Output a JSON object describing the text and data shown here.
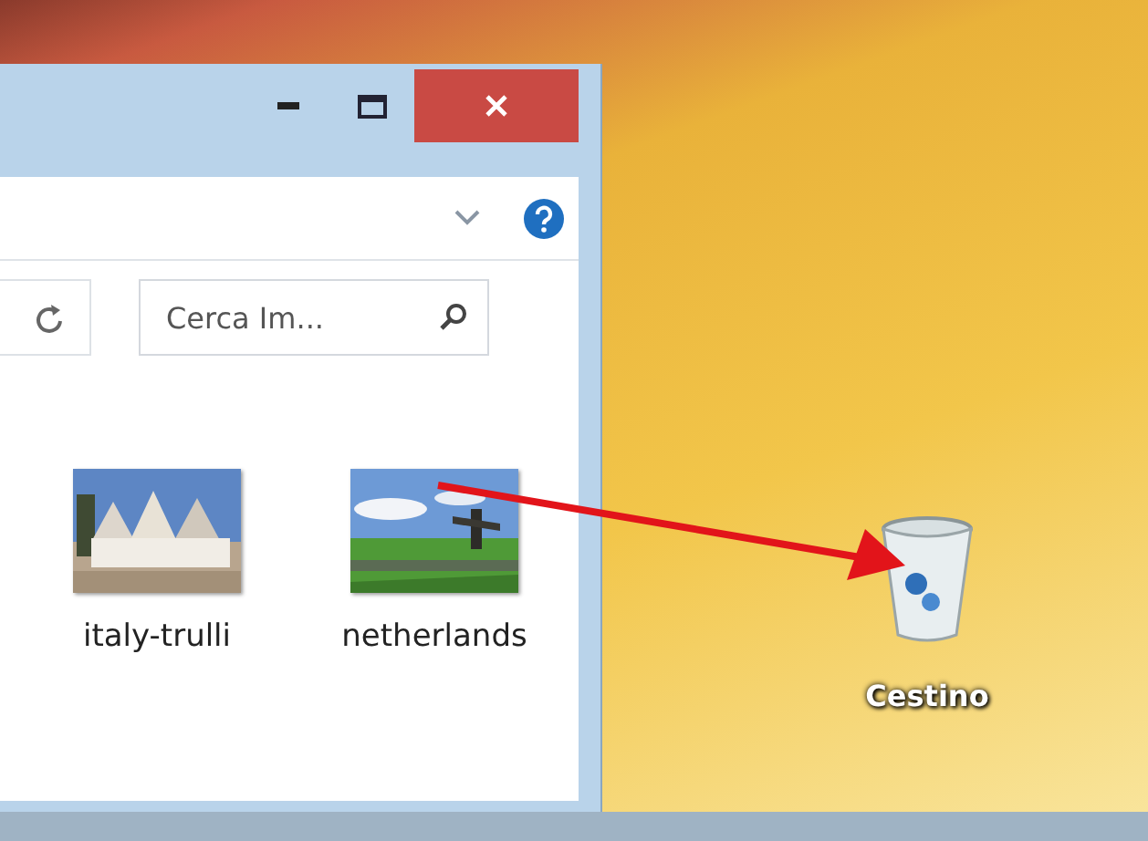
{
  "explorer": {
    "search": {
      "placeholder": "Cerca Im..."
    },
    "files": [
      {
        "name": "italy-trulli",
        "kind": "picture"
      },
      {
        "name": "netherlands",
        "kind": "picture"
      }
    ]
  },
  "desktop": {
    "icons": [
      {
        "label": "Cestino"
      }
    ]
  }
}
